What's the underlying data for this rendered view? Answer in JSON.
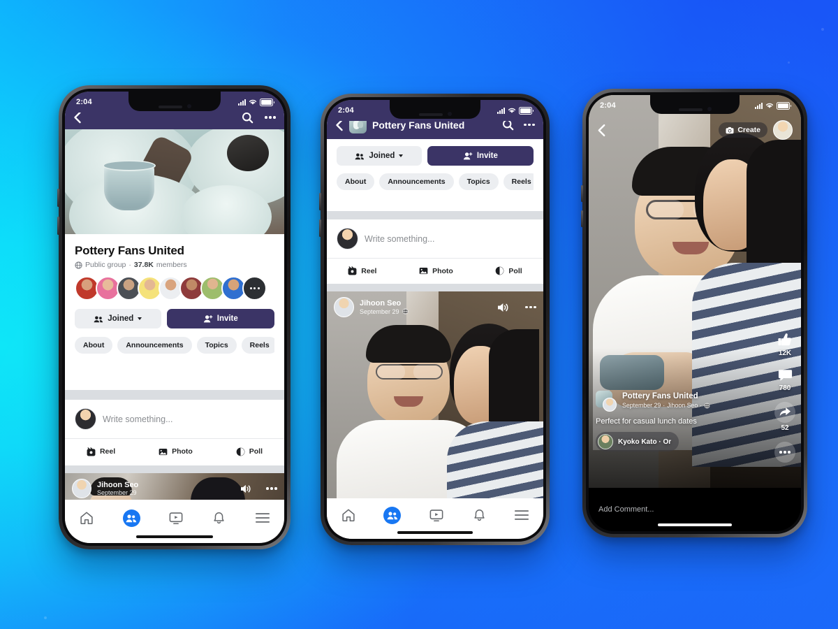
{
  "background": {
    "from": "#12e9f2",
    "to": "#1746f2"
  },
  "brand": {
    "header_purple": "#3b3466",
    "accent_blue": "#1877f2",
    "chip_grey": "#eceef1"
  },
  "status_bar": {
    "time": "2:04",
    "signal": "signal-bars-icon",
    "wifi": "wifi-icon",
    "battery": "battery-full-icon"
  },
  "phone1": {
    "header": {
      "back": "back-chevron-icon",
      "search": "search-icon",
      "more": "more-options-icon"
    },
    "cover_alt": "pottery-cups-cover-photo",
    "group": {
      "name": "Pottery Fans United",
      "privacy": "Public group",
      "separator": "·",
      "members": "37.8K",
      "members_label": "members",
      "member_avatars": 8,
      "overflow_label": "more-members"
    },
    "actions": {
      "joined": "Joined",
      "invite": "Invite"
    },
    "tabs": [
      "About",
      "Announcements",
      "Topics",
      "Reels"
    ],
    "composer": {
      "placeholder": "Write something...",
      "actions": [
        "Reel",
        "Photo",
        "Poll"
      ]
    },
    "post": {
      "author": "Jihoon Seo",
      "date": "September 29",
      "audience": "public-icon"
    },
    "nav": [
      "home",
      "groups",
      "watch",
      "notifications",
      "menu"
    ],
    "nav_active": "groups"
  },
  "phone2": {
    "header": {
      "back": "back-chevron-icon",
      "title": "Pottery Fans United",
      "search": "search-icon",
      "more": "more-options-icon",
      "avatar": "group-avatar"
    },
    "actions": {
      "joined": "Joined",
      "invite": "Invite"
    },
    "tabs": [
      "About",
      "Announcements",
      "Topics",
      "Reels"
    ],
    "composer": {
      "placeholder": "Write something...",
      "actions": [
        "Reel",
        "Photo",
        "Poll"
      ]
    },
    "post": {
      "author": "Jihoon Seo",
      "date": "September 29",
      "audience": "public-icon",
      "sound": "speaker-on-icon",
      "more": "more-options-icon"
    },
    "nav": [
      "home",
      "groups",
      "watch",
      "notifications",
      "menu"
    ],
    "nav_active": "groups"
  },
  "phone3": {
    "header": {
      "back": "back-chevron-icon",
      "create": "Create",
      "camera": "camera-icon",
      "avatar": "profile-avatar"
    },
    "rail": [
      {
        "icon": "like-thumbs-up-icon",
        "count": "12K"
      },
      {
        "icon": "comment-bubble-icon",
        "count": "780"
      },
      {
        "icon": "share-arrow-icon",
        "count": "52"
      },
      {
        "icon": "more-options-icon",
        "count": ""
      }
    ],
    "reel": {
      "group": "Pottery Fans United",
      "date": "September 29",
      "separator": "·",
      "author": "Jihoon Seo",
      "audience": "public-icon",
      "caption": "Perfect for casual lunch dates",
      "tag": "Kyoko Kato · Or"
    },
    "comment_placeholder": "Add Comment..."
  }
}
